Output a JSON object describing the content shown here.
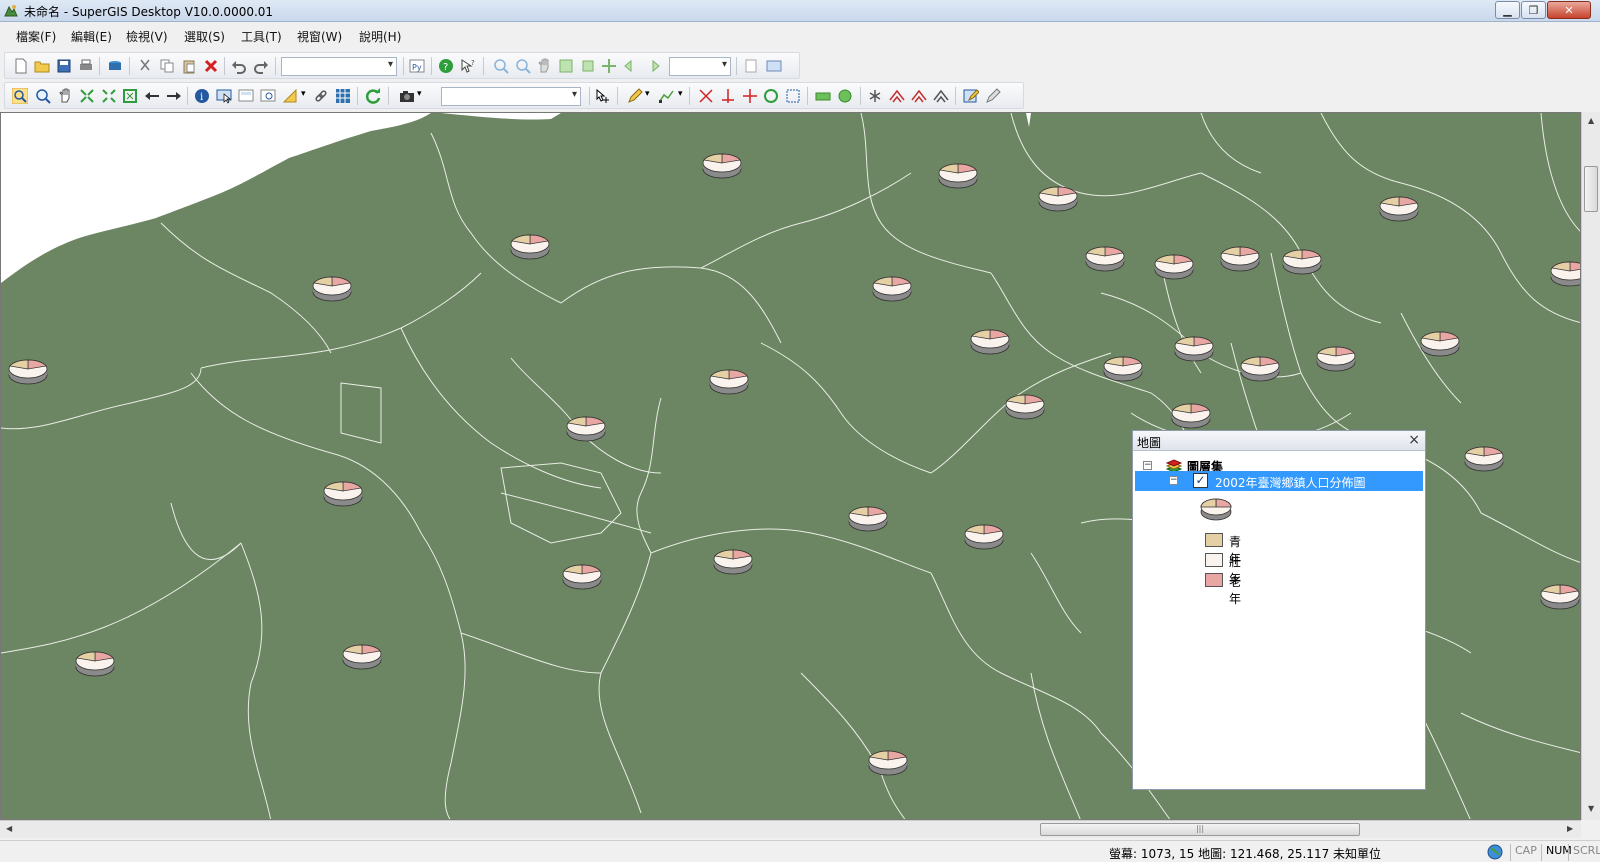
{
  "window": {
    "title": "未命名 - SuperGIS Desktop V10.0.0000.01",
    "minimize_icon": "minimize-icon",
    "maximize_icon": "maximize-icon",
    "close_icon": "close-icon"
  },
  "menubar": {
    "items": [
      "檔案(F)",
      "編輯(E)",
      "檢視(V)",
      "選取(S)",
      "工具(T)",
      "視窗(W)",
      "說明(H)"
    ]
  },
  "toolbar_standard": {
    "icons": [
      "new-file-icon",
      "open-folder-icon",
      "save-icon",
      "print-icon",
      "add-data-icon",
      "cut-icon",
      "copy-icon",
      "paste-icon",
      "delete-icon",
      "undo-icon",
      "redo-icon",
      "python-icon",
      "help-icon",
      "whats-this-icon",
      "zoom-in-icon",
      "zoom-out-icon",
      "pan-icon",
      "full-extent-icon",
      "fixed-zoom-icon",
      "center-icon",
      "previous-extent-icon",
      "next-extent-icon",
      "layout-page-icon",
      "layout-view-icon"
    ],
    "combo1_value": "",
    "scale_value": ""
  },
  "toolbar_map": {
    "icons": [
      "select-zoom-icon",
      "zoom-in-icon",
      "pan-hand-icon",
      "zoom-full-icon",
      "zoom-fit-icon",
      "zoom-box-icon",
      "back-arrow-icon",
      "forward-arrow-icon",
      "identify-icon",
      "select-features-icon",
      "map-tips-icon",
      "find-icon",
      "measure-icon",
      "hyperlink-icon",
      "grid-icon",
      "refresh-icon",
      "camera-icon",
      "pointer-tool-icon",
      "pencil-icon",
      "edit-vertex-icon",
      "cross-tool-icon",
      "split-icon",
      "snap-icon",
      "circle-tool-icon",
      "extent-tool-icon",
      "rectangle-tool-icon",
      "ellipse-tool-icon",
      "merge-icon",
      "reshape-icon",
      "move-vertex-icon",
      "attribute-edit-icon",
      "sketch-props-icon"
    ],
    "layer_combo_value": ""
  },
  "map": {
    "background_color": "#6c8562",
    "land_color": "#6c8562",
    "sea_color": "#ffffff",
    "boundary_color": "#e8eee4",
    "pie_colors": {
      "youth": "#e5cfa5",
      "adult": "#faf2ec",
      "elderly": "#e8a7a3"
    }
  },
  "toc": {
    "title": "地圖",
    "close_label": "×",
    "layer_set_label": "圖層集",
    "layer_name": "2002年臺灣鄉鎮人口分佈圖",
    "layer_checked": true,
    "legend": [
      {
        "label": "青年",
        "color": "#e5cfa5"
      },
      {
        "label": "壯年",
        "color": "#faf2ec"
      },
      {
        "label": "老年",
        "color": "#e8a7a3"
      }
    ]
  },
  "statusbar": {
    "coords": "螢幕: 1073, 15  地圖: 121.468, 25.117 未知單位",
    "cap": "CAP",
    "num": "NUM",
    "scrl": "SCRL"
  }
}
